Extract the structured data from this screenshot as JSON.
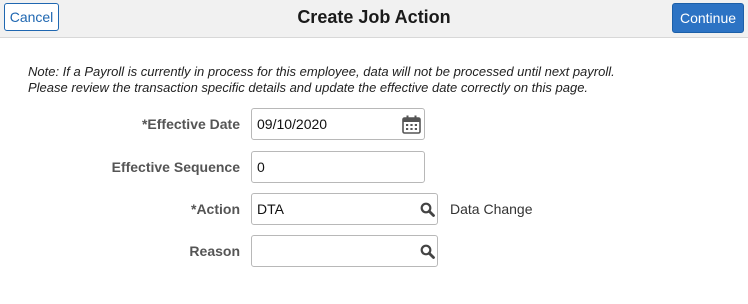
{
  "header": {
    "cancel_label": "Cancel",
    "title": "Create Job Action",
    "continue_label": "Continue"
  },
  "note": {
    "line1": "Note: If a Payroll is currently in process for this employee, data will not be processed until next payroll.",
    "line2": "Please review the transaction specific details and update the effective date correctly on this page."
  },
  "form": {
    "effective_date": {
      "label": "*Effective Date",
      "value": "09/10/2020",
      "icon": "calendar-icon"
    },
    "effective_sequence": {
      "label": "Effective Sequence",
      "value": "0"
    },
    "action": {
      "label": "*Action",
      "value": "DTA",
      "icon": "search-icon",
      "description": "Data Change"
    },
    "reason": {
      "label": "Reason",
      "value": "",
      "icon": "search-icon"
    }
  },
  "colors": {
    "header_bg": "#f1f1f1",
    "primary_blue": "#2c73c4",
    "link_blue": "#1f67b1"
  }
}
